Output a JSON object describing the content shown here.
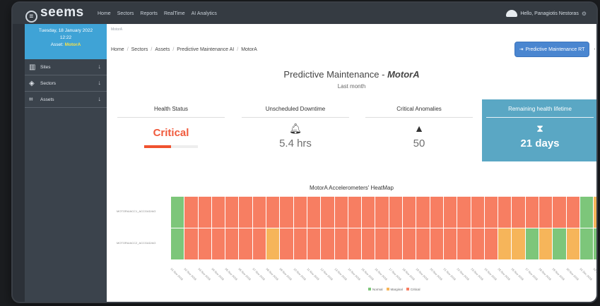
{
  "app": {
    "logo": "seems",
    "nav": [
      "Home",
      "Sectors",
      "Reports",
      "RealTime",
      "AI Analytics"
    ],
    "user_greeting": "Hello, Panagiotis Nestoras"
  },
  "sidebar": {
    "date": "Tuesday, 18 January 2022",
    "time": "12:22",
    "asset_label": "Asset:",
    "asset_value": "MotorA",
    "items": [
      {
        "label": "Sites",
        "icon": "building-icon"
      },
      {
        "label": "Sectors",
        "icon": "layers-icon"
      },
      {
        "label": "Assets",
        "icon": "nodes-icon"
      }
    ]
  },
  "main": {
    "top_crumb": "MotorA",
    "breadcrumb": [
      "Home",
      "Sectors",
      "Assets",
      "Predictive Maintenance AI",
      "MotorA"
    ],
    "pm_button": "Predictive Maintenance RT",
    "title_prefix": "Predictive Maintenance - ",
    "title_asset": "MotorA",
    "subtitle": "Last month",
    "cards": {
      "health": {
        "title": "Health Status",
        "value": "Critical",
        "bar_fraction": 0.5
      },
      "downtime": {
        "title": "Unscheduled Downtime",
        "value": "5.4 hrs",
        "icon": "bell-icon"
      },
      "anomalies": {
        "title": "Critical Anomalies",
        "value": "50",
        "icon": "warning-icon"
      },
      "lifetime": {
        "title": "Remaining health lifetime",
        "value": "21 days",
        "icon": "hourglass-icon"
      }
    }
  },
  "heatmap": {
    "title": "MotorA Accelerometers' HeatMap",
    "row_labels": [
      "MOTORA/ACC1_ACCGAD/AG",
      "MOTORA/ACC2_ACCGAD/AG"
    ],
    "rows": [
      [
        "N",
        "C",
        "C",
        "C",
        "C",
        "C",
        "C",
        "C",
        "C",
        "C",
        "C",
        "C",
        "C",
        "C",
        "C",
        "C",
        "C",
        "C",
        "C",
        "C",
        "C",
        "C",
        "C",
        "C",
        "C",
        "C",
        "C",
        "C",
        "C",
        "C",
        "N",
        "M"
      ],
      [
        "N",
        "C",
        "C",
        "C",
        "C",
        "C",
        "C",
        "M",
        "C",
        "C",
        "C",
        "C",
        "C",
        "C",
        "C",
        "C",
        "C",
        "C",
        "C",
        "C",
        "C",
        "C",
        "C",
        "C",
        "M",
        "M",
        "N",
        "M",
        "N",
        "M",
        "N",
        "N"
      ]
    ],
    "x_labels": [
      "01 Nov 2018",
      "02 Nov 2018",
      "03 Nov 2018",
      "04 Nov 2018",
      "05 Nov 2018",
      "06 Nov 2018",
      "07 Nov 2018",
      "08 Nov 2018",
      "09 Nov 2018",
      "10 Nov 2018",
      "11 Nov 2018",
      "12 Nov 2018",
      "13 Nov 2018",
      "14 Nov 2018",
      "15 Nov 2018",
      "16 Nov 2018",
      "17 Nov 2018",
      "18 Nov 2018",
      "19 Nov 2018",
      "20 Nov 2018",
      "21 Nov 2018",
      "22 Nov 2018",
      "23 Nov 2018",
      "24 Nov 2018",
      "25 Nov 2018",
      "26 Nov 2018",
      "27 Nov 2018",
      "28 Nov 2018",
      "29 Nov 2018",
      "30 Nov 2018",
      "01 Dec 2018",
      "02 Dec 2018"
    ],
    "legend": [
      {
        "code": "N",
        "label": "Normal",
        "color": "#7dc67a"
      },
      {
        "code": "M",
        "label": "Marginal",
        "color": "#f6b55a"
      },
      {
        "code": "C",
        "label": "Critical",
        "color": "#f77e62"
      }
    ]
  }
}
